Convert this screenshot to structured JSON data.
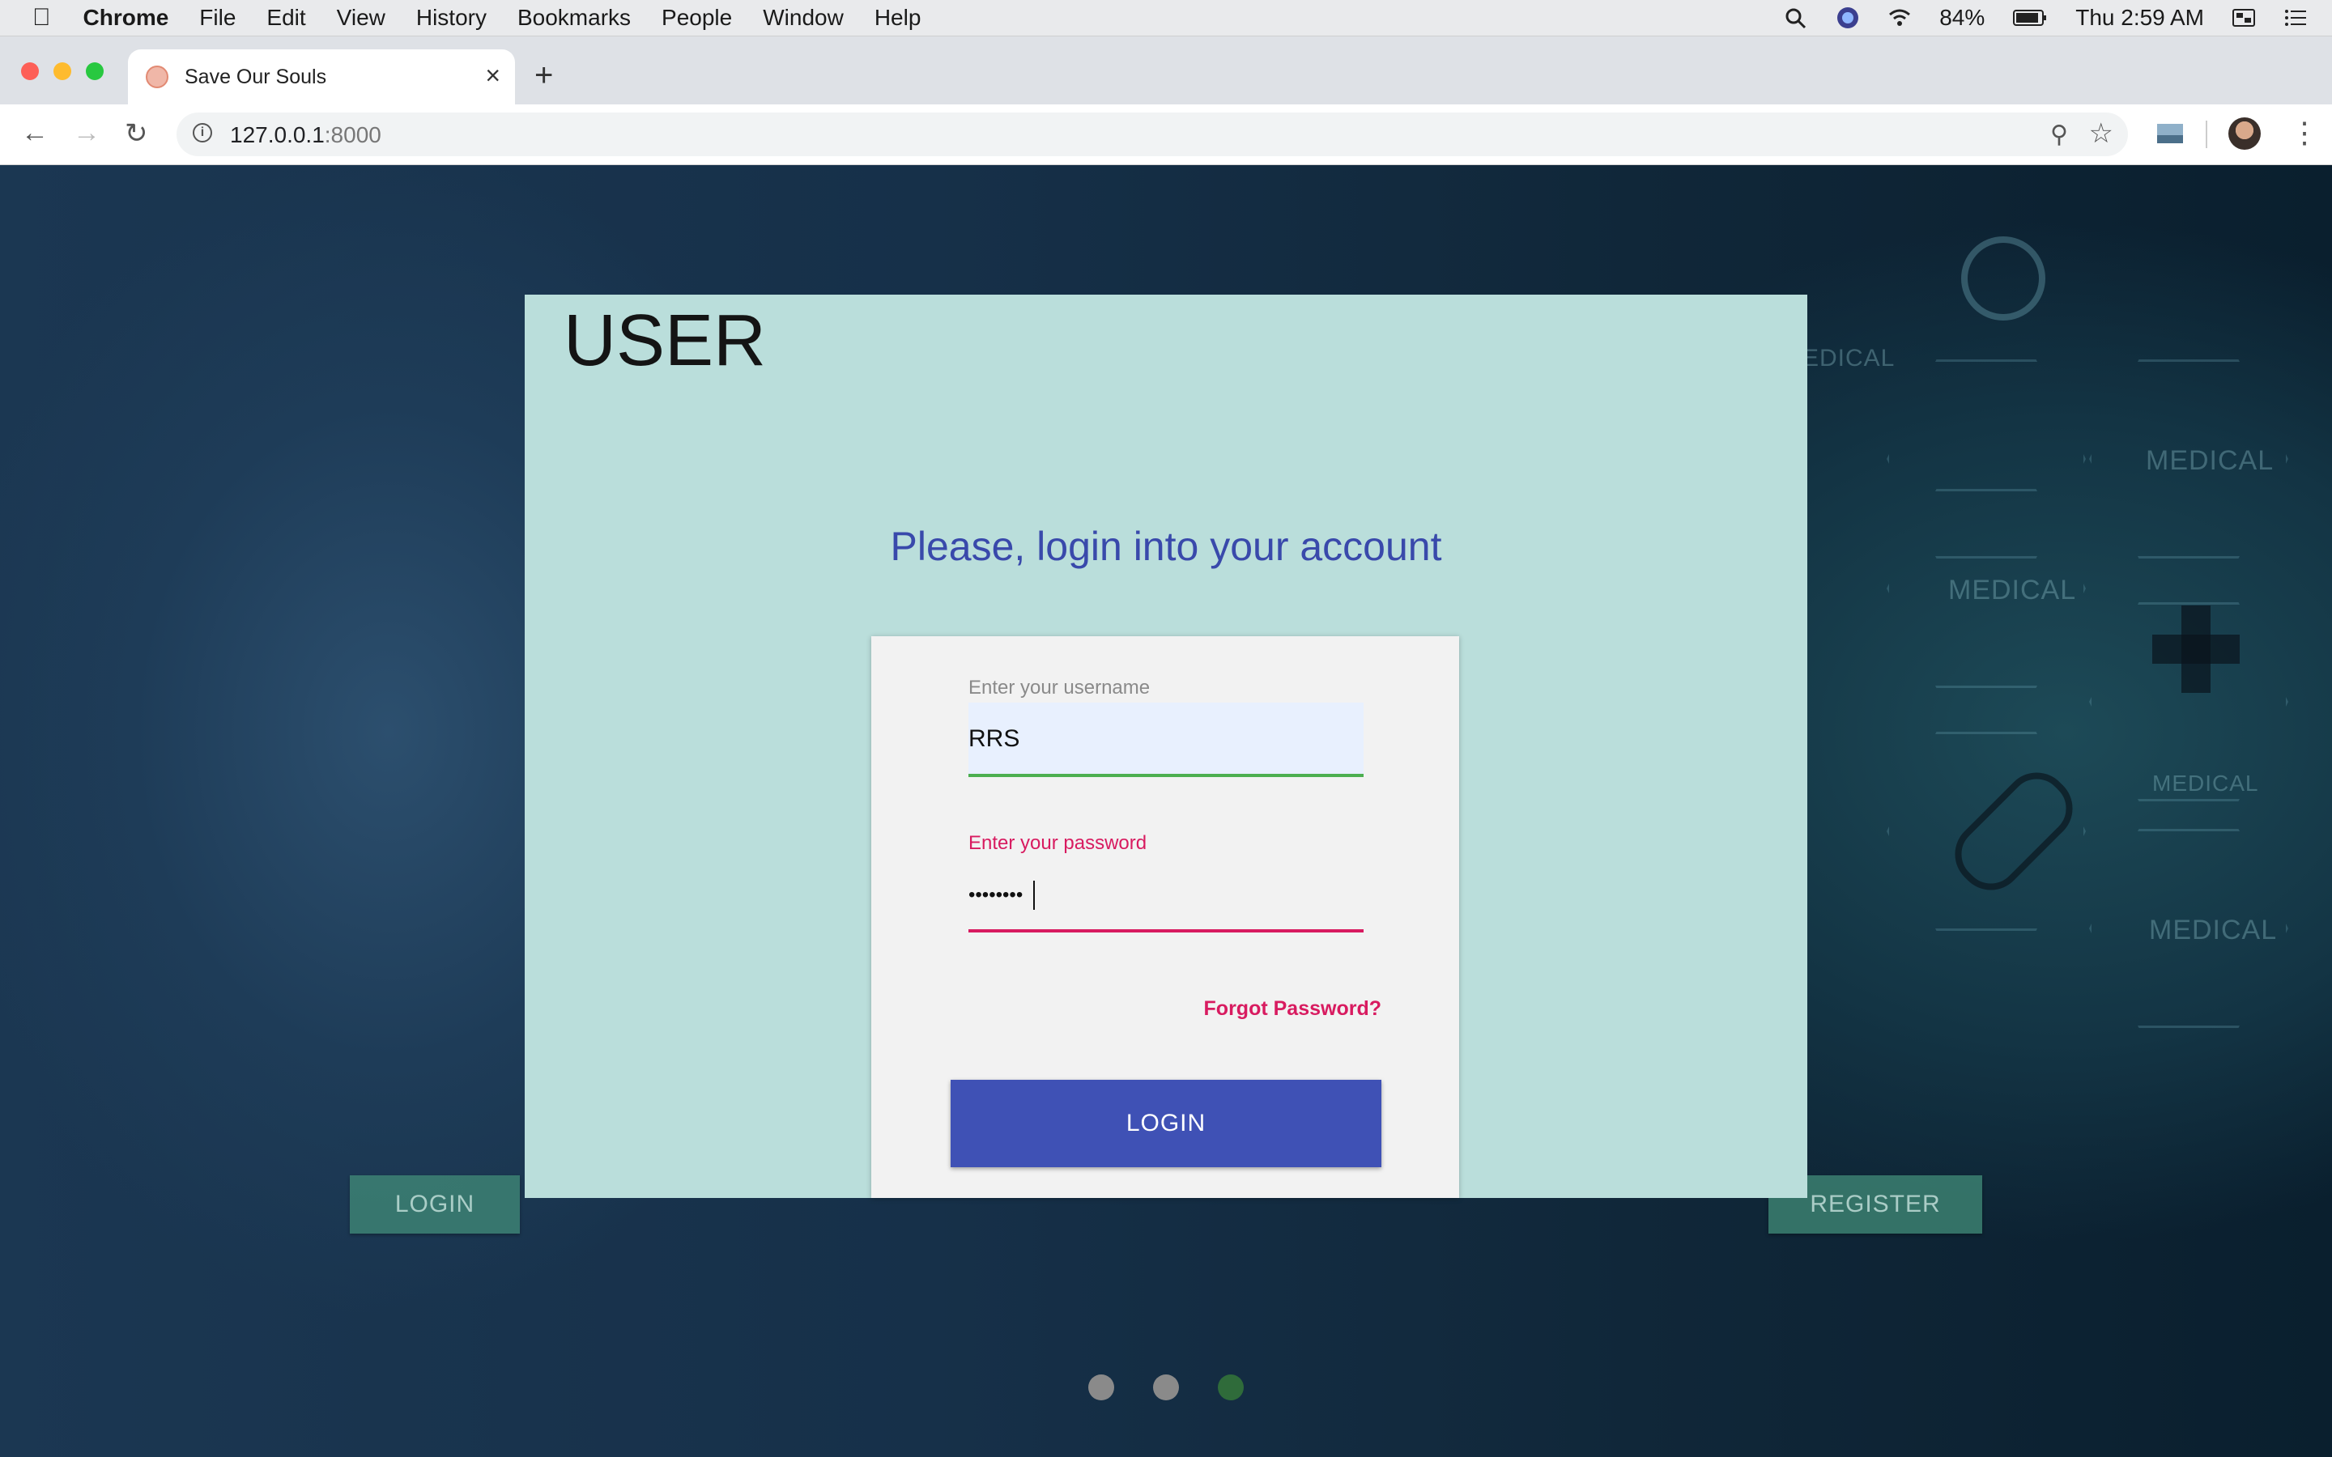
{
  "menubar": {
    "app": "Chrome",
    "items": [
      "File",
      "Edit",
      "View",
      "History",
      "Bookmarks",
      "People",
      "Window",
      "Help"
    ],
    "battery": "84%",
    "clock": "Thu 2:59 AM"
  },
  "browser": {
    "tab_title": "Save Our Souls",
    "url_host": "127.0.0.1",
    "url_port": ":8000"
  },
  "background": {
    "hex_labels": [
      "MEDICAL",
      "MEDICAL",
      "MEDICAL",
      "MEDICAL",
      "MEDICAL"
    ],
    "login_button": "LOGIN",
    "register_button": "REGISTER",
    "carousel_active_index": 2,
    "carousel_colors": {
      "inactive": "#8a8a8a",
      "active": "#2f6b3a"
    }
  },
  "modal": {
    "title": "USER",
    "subtitle": "Please, login into your account",
    "username_label": "Enter your username",
    "username_value": "RRS",
    "password_label": "Enter your password",
    "password_value": "••••••••",
    "forgot_link": "Forgot Password?",
    "login_button": "LOGIN"
  },
  "colors": {
    "modal_bg": "#badedb",
    "accent_blue": "#3f51b5",
    "accent_pink": "#d81b60",
    "valid_green": "#4caf50"
  }
}
